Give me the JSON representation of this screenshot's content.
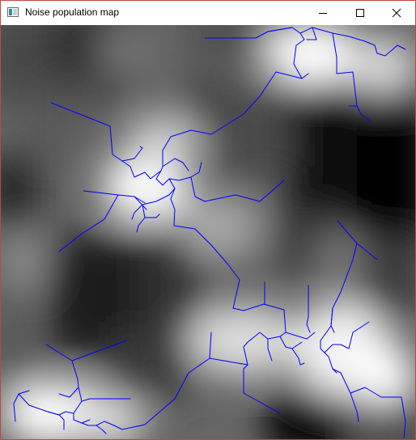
{
  "window": {
    "title": "Noise population map",
    "controls": {
      "minimize_icon": "minimize-icon",
      "maximize_icon": "maximize-icon",
      "close_icon": "close-icon"
    },
    "border_color": "#c2473f"
  },
  "map": {
    "description_colors": {
      "road_color": "#0000ff",
      "dark": "#000000",
      "light": "#ffffff"
    }
  }
}
